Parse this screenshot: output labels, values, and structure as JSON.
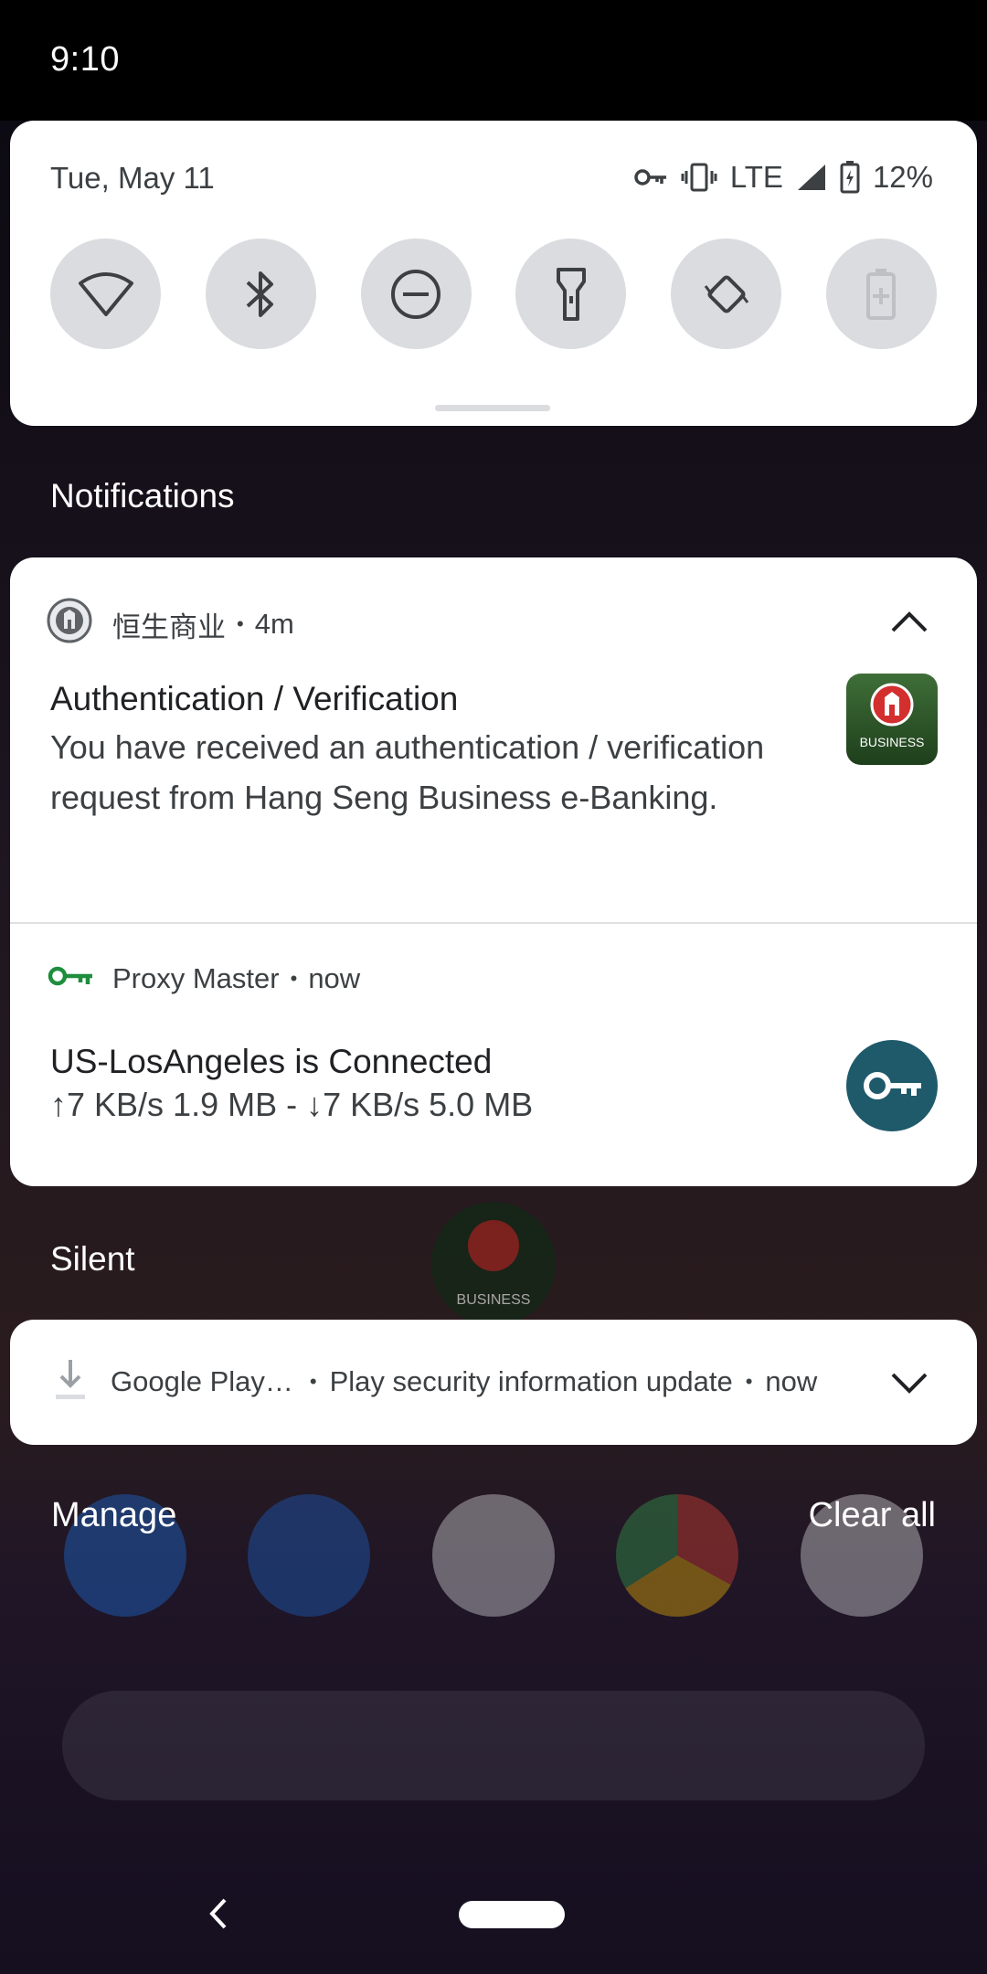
{
  "status_bar": {
    "time": "9:10"
  },
  "quick_settings": {
    "date": "Tue, May 11",
    "network": "LTE",
    "battery": "12%",
    "tiles": [
      "wifi-icon",
      "bluetooth-icon",
      "do-not-disturb-icon",
      "flashlight-icon",
      "auto-rotate-icon",
      "battery-saver-icon"
    ]
  },
  "sections": {
    "notifications": "Notifications",
    "silent": "Silent"
  },
  "notifications": [
    {
      "app": "恒生商业",
      "time": "4m",
      "title": "Authentication / Verification",
      "body": "You have received an authentication / verification request from Hang Seng Business e-Banking.",
      "thumb_label": "BUSINESS",
      "thumb_color": "#2d5a2a"
    },
    {
      "app": "Proxy Master",
      "time": "now",
      "title": "US-LosAngeles is Connected",
      "body": "↑7 KB/s 1.9 MB - ↓7 KB/s 5.0 MB",
      "icon_color": "#1e8e3e",
      "thumb_color": "#1f5a6b"
    }
  ],
  "silent_notification": {
    "app": "Google Play…",
    "text": "Play security information update",
    "time": "now"
  },
  "actions": {
    "manage": "Manage",
    "clear_all": "Clear all"
  },
  "background": {
    "app_label": "BUSINESS"
  }
}
